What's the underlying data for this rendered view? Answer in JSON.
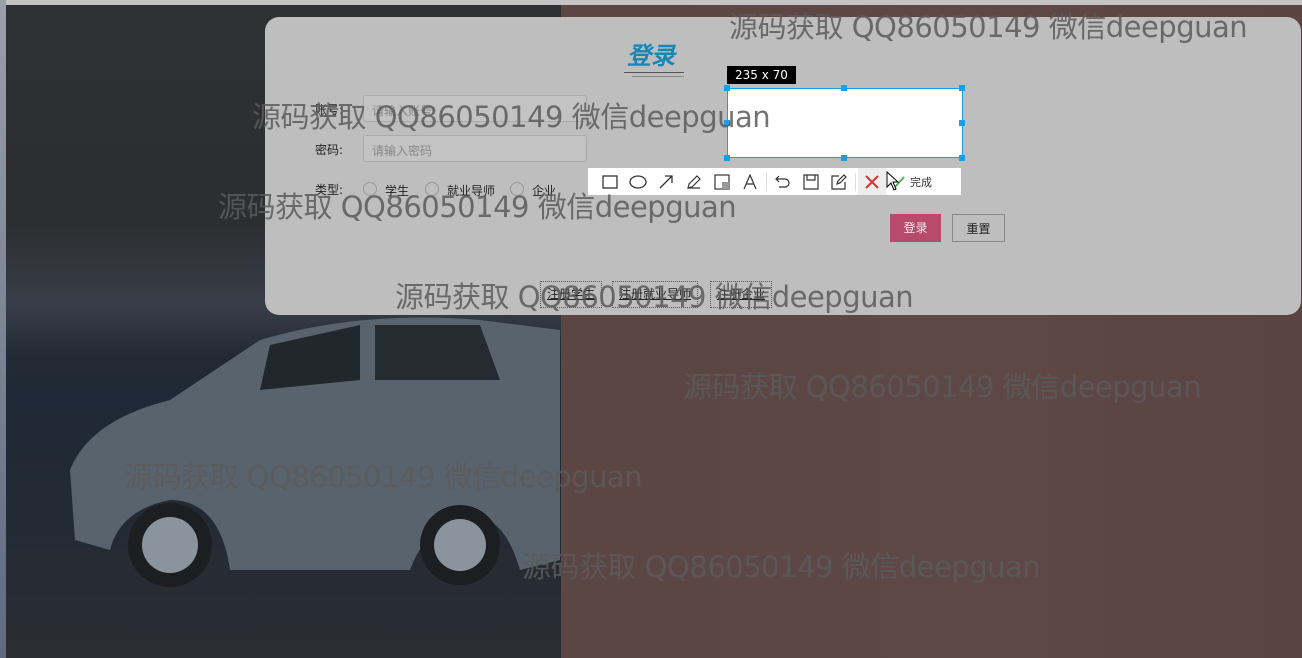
{
  "login": {
    "title": "登录",
    "account_label": "账号:",
    "account_placeholder": "请输入账号",
    "password_label": "密码:",
    "password_placeholder": "请输入密码",
    "type_label": "类型:",
    "types": [
      "学生",
      "就业导师",
      "企业"
    ],
    "login_button": "登录",
    "reset_button": "重置",
    "links": [
      "注册学生",
      "注册就业导师",
      "注册企业"
    ]
  },
  "capture": {
    "size": "235 x 70",
    "done": "完成"
  },
  "watermark": "源码获取 QQ86050149 微信deepguan",
  "colors": {
    "title": "#1a86b3",
    "login_button": "#b84a6e",
    "selection": "#1c9ee6"
  }
}
